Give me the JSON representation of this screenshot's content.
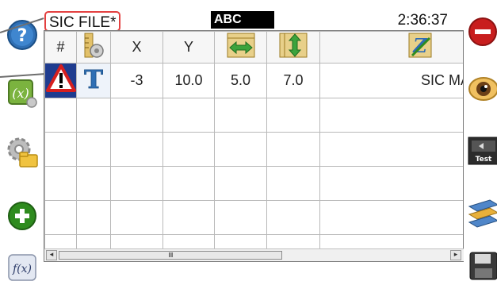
{
  "header": {
    "file_title": "SIC FILE*",
    "mode": "ABC",
    "time": "2:36:37"
  },
  "table": {
    "columns": [
      "#",
      "",
      "X",
      "Y",
      "",
      "",
      ""
    ],
    "rows": [
      {
        "status_icon": "warning-icon",
        "type_icon": "text-type-icon",
        "x": "-3",
        "y": "10.0",
        "width": "5.0",
        "height": "7.0",
        "text": "SIC MARKING"
      }
    ]
  },
  "scrollbar": {
    "thumb_label": "IIII"
  },
  "icons": {
    "left": [
      "help-icon",
      "variable-icon",
      "settings-folder-icon",
      "add-icon",
      "function-icon"
    ],
    "right": [
      "stop-icon",
      "preview-eye-icon",
      "test-icon",
      "layers-icon",
      "save-icon"
    ]
  },
  "colors": {
    "warning": "#d61f1f",
    "add": "#2e8b1e",
    "stop": "#c81e1e",
    "highlight": "#e34040"
  }
}
